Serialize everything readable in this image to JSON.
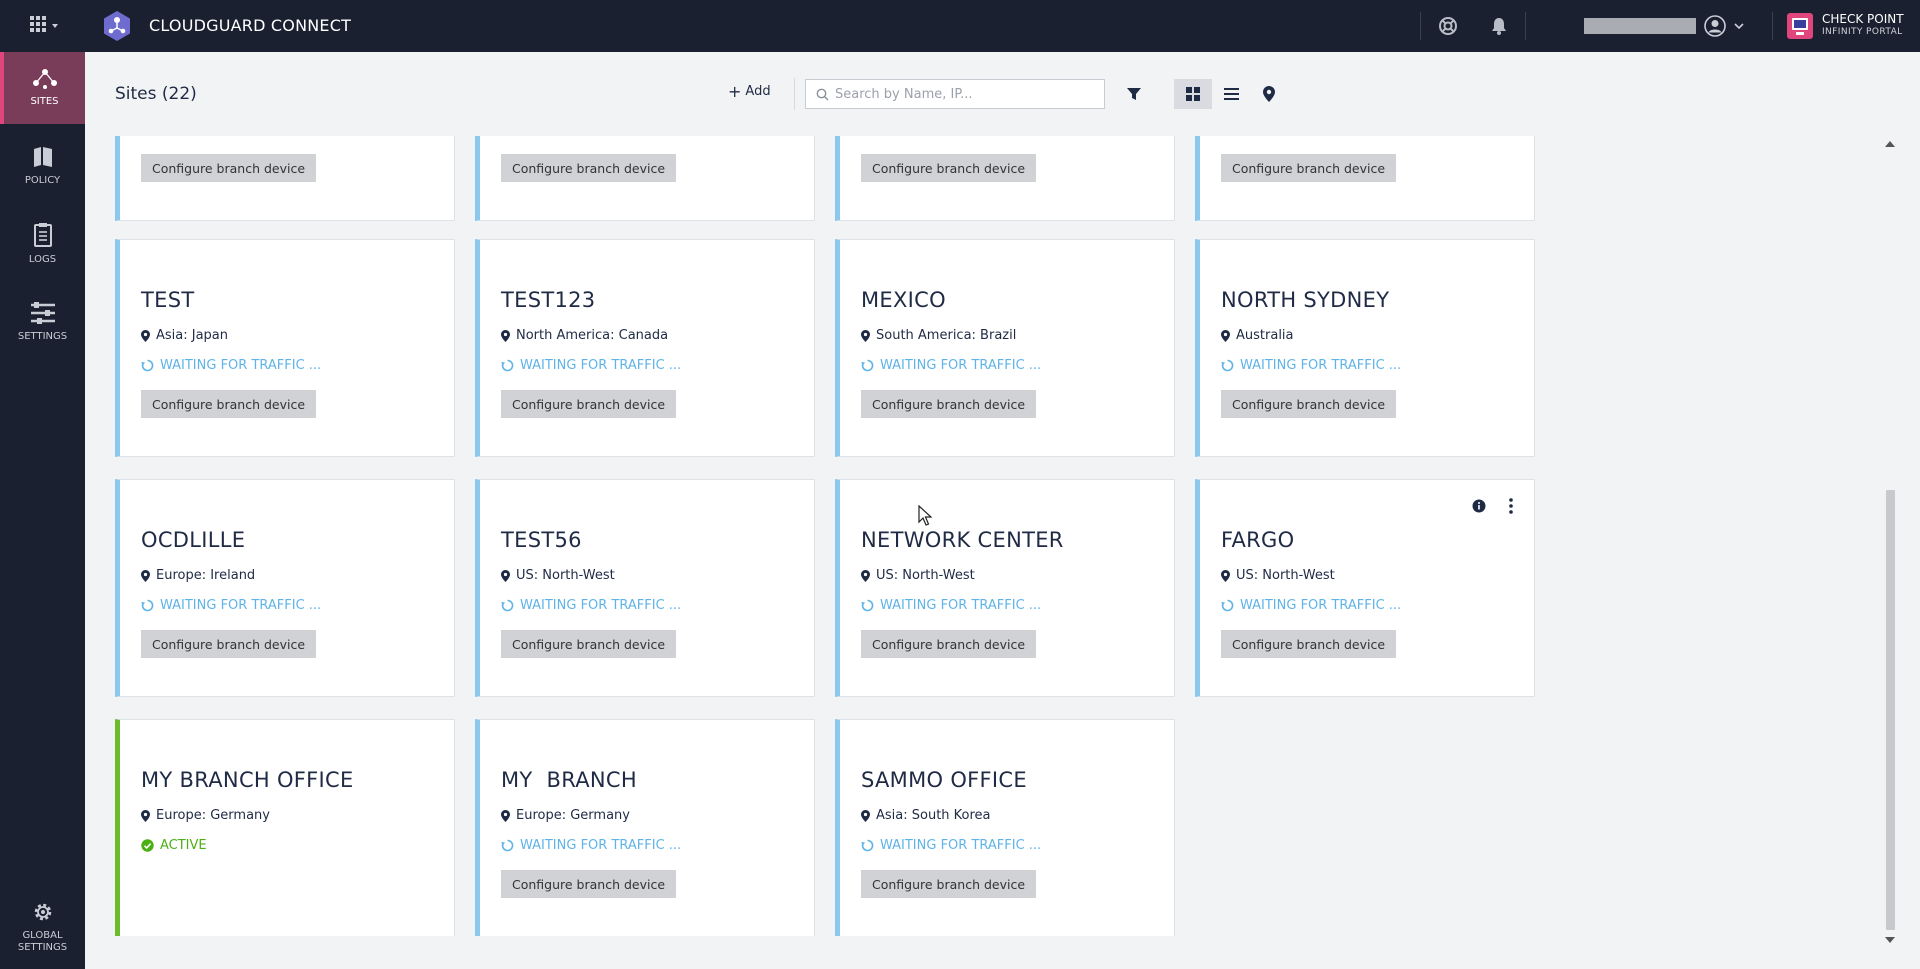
{
  "app": {
    "title": "CLOUDGUARD CONNECT"
  },
  "brand": {
    "line1": "CHECK POINT",
    "line2": "INFINITY PORTAL"
  },
  "sidebar": {
    "items": [
      {
        "label": "SITES",
        "icon": "sites-icon",
        "active": true
      },
      {
        "label": "POLICY",
        "icon": "policy-icon"
      },
      {
        "label": "LOGS",
        "icon": "logs-icon"
      },
      {
        "label": "SETTINGS",
        "icon": "settings-icon"
      }
    ],
    "global": {
      "label_line1": "GLOBAL",
      "label_line2": "SETTINGS",
      "icon": "gear-icon"
    }
  },
  "header": {
    "title": "Sites (22)",
    "add_label": "Add",
    "search_placeholder": "Search by Name, IP..."
  },
  "colors": {
    "accent_waiting": "#5fb3e8",
    "accent_active": "#6cbb2b",
    "sidebar_active": "#7a3d59",
    "topbar": "#1b2030"
  },
  "sites": {
    "partial": [
      {
        "button": "Configure branch device"
      },
      {
        "button": "Configure branch device"
      },
      {
        "button": "Configure branch device"
      },
      {
        "button": "Configure branch device"
      }
    ],
    "row1": [
      {
        "name": "TEST",
        "location": "Asia: Japan",
        "status": "WAITING FOR TRAFFIC ...",
        "button": "Configure branch device"
      },
      {
        "name": "TEST123",
        "location": "North America: Canada",
        "status": "WAITING FOR TRAFFIC ...",
        "button": "Configure branch device"
      },
      {
        "name": "MEXICO",
        "location": "South America: Brazil",
        "status": "WAITING FOR TRAFFIC ...",
        "button": "Configure branch device"
      },
      {
        "name": "NORTH SYDNEY",
        "location": "Australia",
        "status": "WAITING FOR TRAFFIC ...",
        "button": "Configure branch device"
      }
    ],
    "row2": [
      {
        "name": "OCDLILLE",
        "location": "Europe: Ireland",
        "status": "WAITING FOR TRAFFIC ...",
        "button": "Configure branch device"
      },
      {
        "name": "TEST56",
        "location": "US: North-West",
        "status": "WAITING FOR TRAFFIC ...",
        "button": "Configure branch device"
      },
      {
        "name": "NETWORK CENTER",
        "location": "US: North-West",
        "status": "WAITING FOR TRAFFIC ...",
        "button": "Configure branch device"
      },
      {
        "name": "FARGO",
        "location": "US: North-West",
        "status": "WAITING FOR TRAFFIC ...",
        "button": "Configure branch device"
      }
    ],
    "row3": [
      {
        "name": "MY BRANCH OFFICE",
        "location": "Europe: Germany",
        "status": "ACTIVE"
      },
      {
        "name": "MY  BRANCH",
        "location": "Europe: Germany",
        "status": "WAITING FOR TRAFFIC ...",
        "button": "Configure branch device"
      },
      {
        "name": "SAMMO OFFICE",
        "location": "Asia: South Korea",
        "status": "WAITING FOR TRAFFIC ...",
        "button": "Configure branch device"
      }
    ]
  }
}
